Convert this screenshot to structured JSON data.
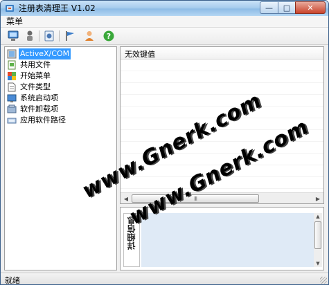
{
  "window": {
    "title": "注册表清理王 V1.02",
    "icon": "registry-app-icon"
  },
  "menubar": {
    "items": [
      "菜单"
    ]
  },
  "toolbar": {
    "buttons": [
      {
        "name": "scan-icon"
      },
      {
        "name": "brush-icon"
      },
      {
        "name": "settings-icon"
      },
      {
        "name": "flag-icon"
      },
      {
        "name": "user-icon"
      },
      {
        "name": "help-icon"
      }
    ]
  },
  "tree": {
    "items": [
      {
        "label": "ActiveX/COM",
        "icon": "activex-icon",
        "selected": true
      },
      {
        "label": "共用文件",
        "icon": "shared-files-icon",
        "selected": false
      },
      {
        "label": "开始菜单",
        "icon": "start-menu-icon",
        "selected": false
      },
      {
        "label": "文件类型",
        "icon": "file-type-icon",
        "selected": false
      },
      {
        "label": "系统启动项",
        "icon": "startup-icon",
        "selected": false
      },
      {
        "label": "软件卸载项",
        "icon": "uninstall-icon",
        "selected": false
      },
      {
        "label": "应用软件路径",
        "icon": "app-path-icon",
        "selected": false
      }
    ]
  },
  "list": {
    "column_header": "无效键值",
    "scroll_grip": "III"
  },
  "detail": {
    "tab_label": "详细信息"
  },
  "statusbar": {
    "text": "就绪"
  },
  "watermark": {
    "text1": "www.Gnerk.com",
    "text2": "www.Gnerk.com"
  },
  "colors": {
    "selection": "#3399ff",
    "titlebar": "#a8cdee",
    "detail_background": "#dfeaf6"
  }
}
